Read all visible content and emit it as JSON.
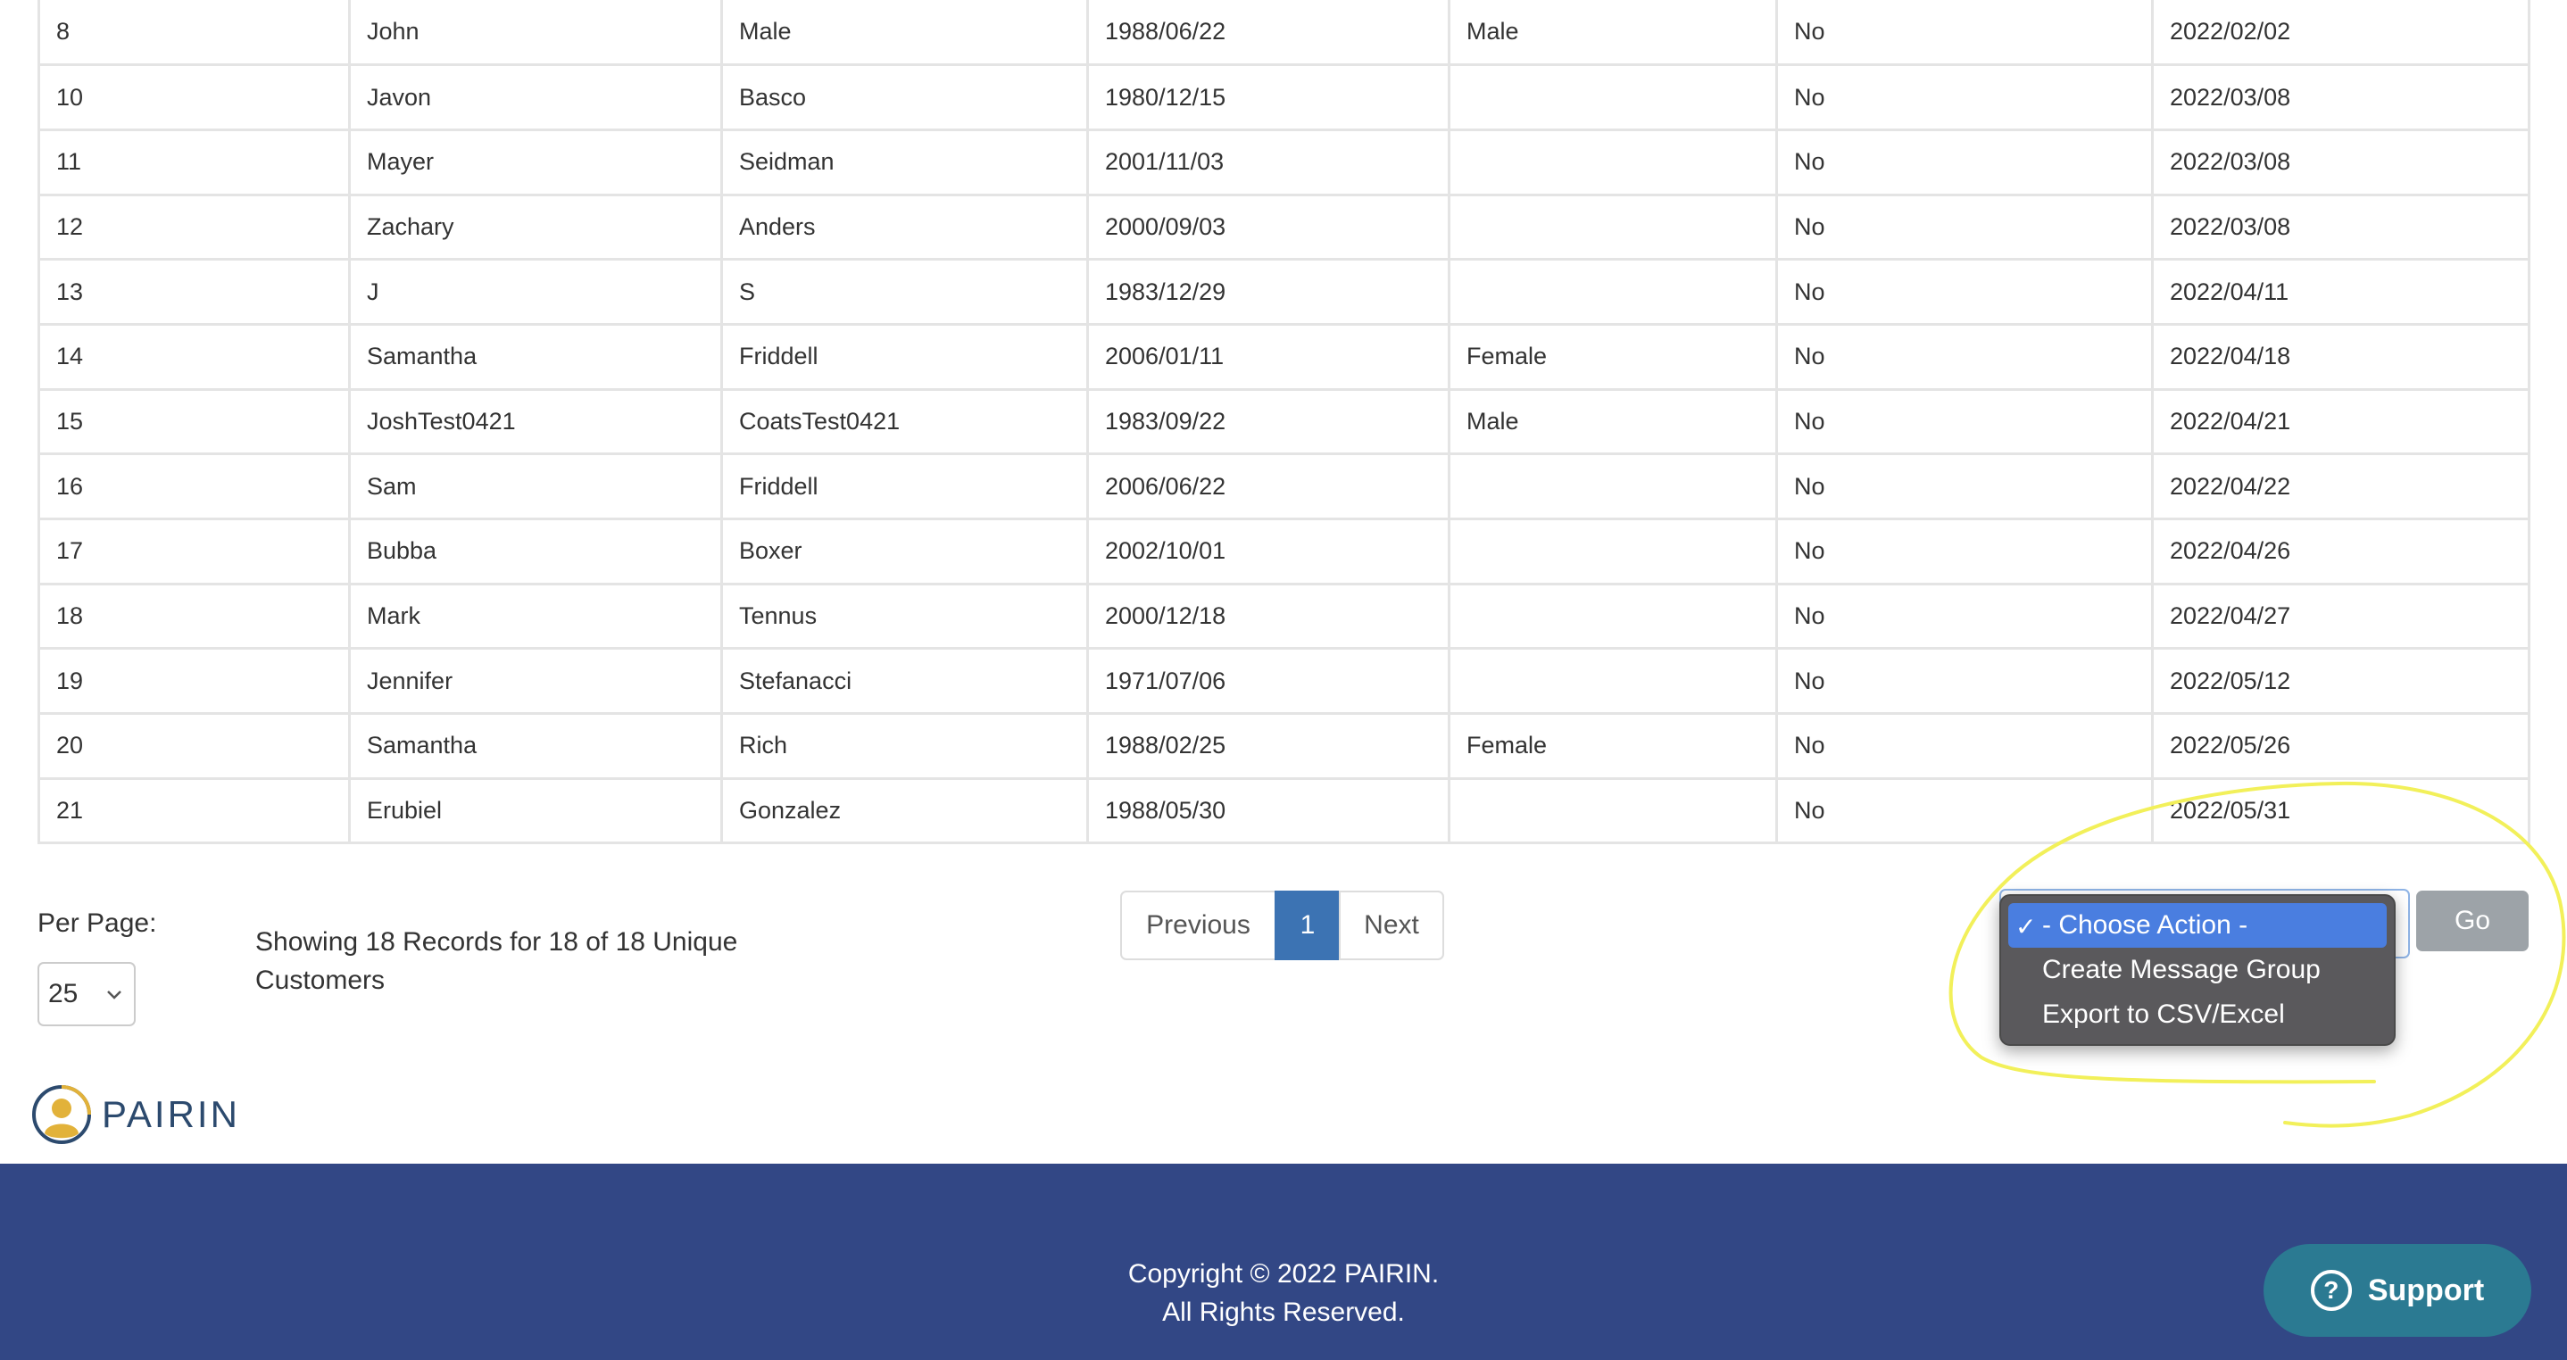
{
  "table": {
    "rows": [
      [
        "8",
        "John",
        "Male",
        "1988/06/22",
        "Male",
        "No",
        "2022/02/02"
      ],
      [
        "10",
        "Javon",
        "Basco",
        "1980/12/15",
        "",
        "No",
        "2022/03/08"
      ],
      [
        "11",
        "Mayer",
        "Seidman",
        "2001/11/03",
        "",
        "No",
        "2022/03/08"
      ],
      [
        "12",
        "Zachary",
        "Anders",
        "2000/09/03",
        "",
        "No",
        "2022/03/08"
      ],
      [
        "13",
        "J",
        "S",
        "1983/12/29",
        "",
        "No",
        "2022/04/11"
      ],
      [
        "14",
        "Samantha",
        "Friddell",
        "2006/01/11",
        "Female",
        "No",
        "2022/04/18"
      ],
      [
        "15",
        "JoshTest0421",
        "CoatsTest0421",
        "1983/09/22",
        "Male",
        "No",
        "2022/04/21"
      ],
      [
        "16",
        "Sam",
        "Friddell",
        "2006/06/22",
        "",
        "No",
        "2022/04/22"
      ],
      [
        "17",
        "Bubba",
        "Boxer",
        "2002/10/01",
        "",
        "No",
        "2022/04/26"
      ],
      [
        "18",
        "Mark",
        "Tennus",
        "2000/12/18",
        "",
        "No",
        "2022/04/27"
      ],
      [
        "19",
        "Jennifer",
        "Stefanacci",
        "1971/07/06",
        "",
        "No",
        "2022/05/12"
      ],
      [
        "20",
        "Samantha",
        "Rich",
        "1988/02/25",
        "Female",
        "No",
        "2022/05/26"
      ],
      [
        "21",
        "Erubiel",
        "Gonzalez",
        "1988/05/30",
        "",
        "No",
        "2022/05/31"
      ]
    ]
  },
  "per_page": {
    "label": "Per Page:",
    "value": "25"
  },
  "showing_text": "Showing 18 Records for 18 of 18 Unique Customers",
  "pagination": {
    "previous": "Previous",
    "current": "1",
    "next": "Next"
  },
  "action": {
    "options": [
      {
        "label": "- Choose Action -",
        "selected": true
      },
      {
        "label": "Create Message Group",
        "selected": false
      },
      {
        "label": "Export to CSV/Excel",
        "selected": false
      }
    ],
    "check_glyph": "✓",
    "go_label": "Go"
  },
  "logo": {
    "text": "PAIRIN"
  },
  "footer": {
    "line1": "Copyright © 2022 PAIRIN.",
    "line2": "All Rights Reserved.",
    "support_label": "Support"
  },
  "colors": {
    "footer_bg": "#324785",
    "pager_active": "#3c73b3",
    "highlight": "#f2f05a",
    "support_bg": "#2b7a92"
  }
}
